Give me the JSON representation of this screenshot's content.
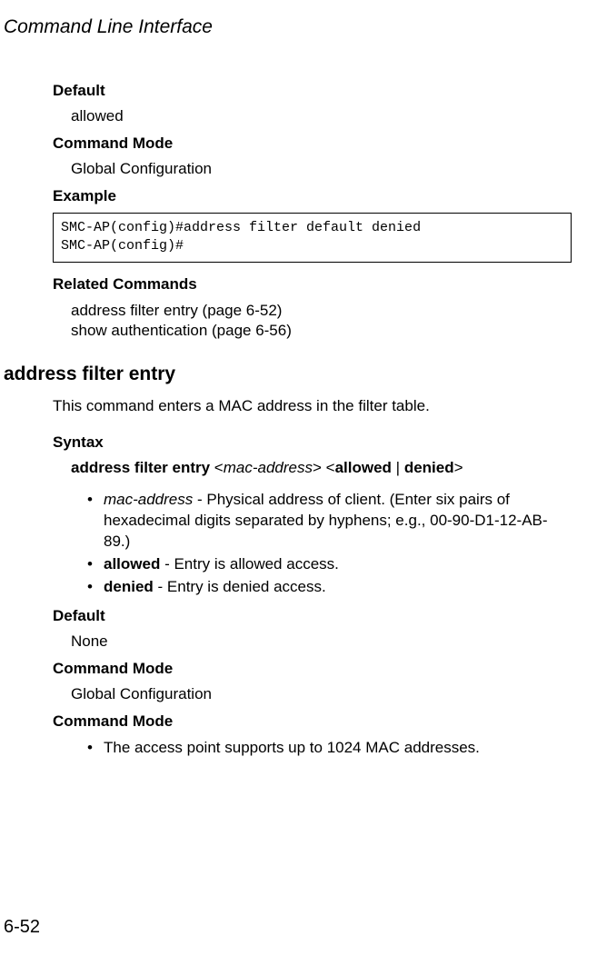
{
  "header": "Command Line Interface",
  "sec1": {
    "default_label": "Default",
    "default_value": "allowed",
    "cmdmode_label": "Command Mode",
    "cmdmode_value": "Global Configuration",
    "example_label": "Example",
    "code_line1": "SMC-AP(config)#address filter default denied",
    "code_line2": "SMC-AP(config)#",
    "related_label": "Related Commands",
    "related_line1": "address filter entry (page 6-52)",
    "related_line2": "show authentication (page 6-56)"
  },
  "cmd": {
    "title": "address filter entry",
    "desc": "This command enters a MAC address in the filter table.",
    "syntax_label": "Syntax",
    "syn_b1": "address filter entry",
    "syn_lt1": " <",
    "syn_i1": "mac-address",
    "syn_gt1": "> <",
    "syn_b2": "allowed",
    "syn_pipe": " | ",
    "syn_b3": "denied",
    "syn_gt2": ">",
    "bullet": "•",
    "p1_i": "mac-address",
    "p1_rest": " - Physical address of client. (Enter six pairs of hexadecimal digits separated by hyphens; e.g., 00-90-D1-12-AB-89.)",
    "p2_b": "allowed",
    "p2_rest": " - Entry is allowed access.",
    "p3_b": "denied",
    "p3_rest": " - Entry is denied access.",
    "default_label": "Default",
    "default_value": "None",
    "cmdmode_label": "Command Mode",
    "cmdmode_value": "Global Configuration",
    "cmdmode2_label": "Command Mode",
    "note_bullet": "•",
    "note_text": " The access point supports up to 1024 MAC addresses."
  },
  "page_number": "6-52"
}
